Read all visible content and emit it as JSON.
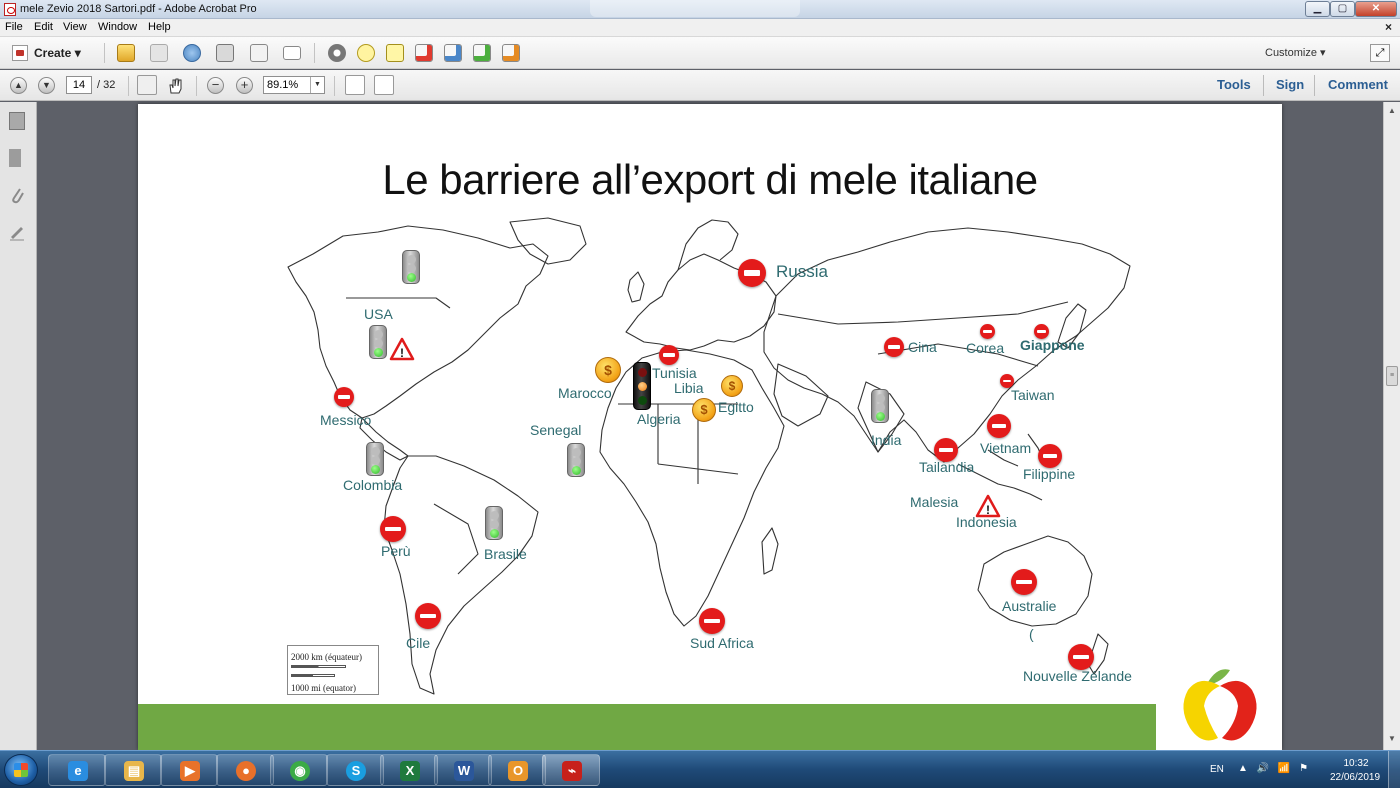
{
  "window": {
    "title": "mele Zevio 2018 Sartori.pdf - Adobe Acrobat Pro",
    "min_label": "▁",
    "max_label": "▢",
    "close_label": "✕"
  },
  "menu": {
    "items": [
      "File",
      "Edit",
      "View",
      "Window",
      "Help"
    ],
    "close_doc": "×"
  },
  "toolbar1": {
    "create_label": "Create ▾",
    "customize_label": "Customize ▾",
    "expand_label": "⤢"
  },
  "toolbar2": {
    "page_current": "14",
    "page_total": "/ 32",
    "zoom_value": "89.1%",
    "zoom_dropdown": "▼",
    "prev_label": "▲",
    "next_label": "▼",
    "zoom_out_label": "−",
    "zoom_in_label": "+",
    "tabs": [
      "Tools",
      "Sign",
      "Comment"
    ]
  },
  "scrollbar": {
    "up": "▲",
    "down": "▼",
    "grip": "≡"
  },
  "slide": {
    "title": "Le barriere all’export di mele italiane",
    "labels": {
      "russia": "Russia",
      "usa": "USA",
      "messico": "Messico",
      "colombia": "Colombia",
      "peru": "Perù",
      "brasile": "Brasile",
      "cile": "Cile",
      "marocco": "Marocco",
      "tunisia": "Tunisia",
      "libia": "Libia",
      "algeria": "Algeria",
      "egitto": "Egitto",
      "senegal": "Senegal",
      "sud_africa": "Sud Africa",
      "cina": "Cina",
      "corea": "Corea",
      "giappone": "Giappone",
      "taiwan": "Taiwan",
      "india": "India",
      "vietnam": "Vietnam",
      "tailandia": "Tailandia",
      "filippine": "Filippine",
      "malesia": "Malesia",
      "indonesia": "Indonesia",
      "australie": "Australie",
      "paren": "(",
      "nouvelle_zelande": "Nouvelle Zélande"
    },
    "scale": {
      "km": "2000 km (équateur)",
      "mi": "1000 mi (equator)"
    },
    "coin_symbol": "$",
    "warning_symbol": "!"
  },
  "taskbar": {
    "apps": [
      {
        "name": "internet-explorer",
        "glyph": "e",
        "color": "#2a8de0"
      },
      {
        "name": "file-explorer",
        "glyph": "▤",
        "color": "#e8b64a"
      },
      {
        "name": "media-player",
        "glyph": "▶",
        "color": "#e8722a"
      },
      {
        "name": "firefox",
        "glyph": "●",
        "color": "#e8702a"
      },
      {
        "name": "chrome",
        "glyph": "◉",
        "color": "#3bab46"
      },
      {
        "name": "skype",
        "glyph": "S",
        "color": "#1a9ee0"
      },
      {
        "name": "excel",
        "glyph": "X",
        "color": "#1f7a3d"
      },
      {
        "name": "word",
        "glyph": "W",
        "color": "#2b579a"
      },
      {
        "name": "outlook",
        "glyph": "O",
        "color": "#e8962a"
      },
      {
        "name": "acrobat",
        "glyph": "⌁",
        "color": "#c7211b"
      }
    ],
    "lang": "EN",
    "tray": "▲ 🔊 📶 ⚑",
    "time": "10:32",
    "date": "22/06/2019"
  }
}
